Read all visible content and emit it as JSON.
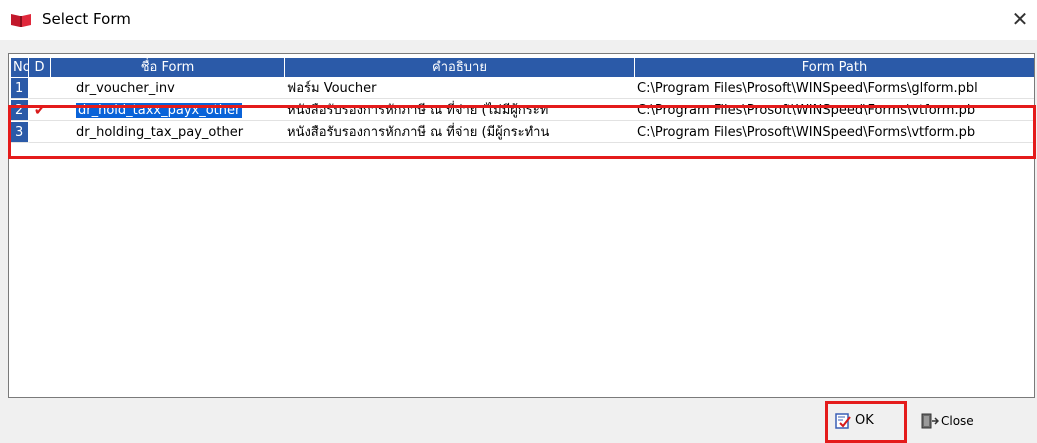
{
  "window": {
    "title": "Select Form",
    "close_glyph": "✕"
  },
  "grid": {
    "columns": [
      "No.",
      "D",
      "ชื่อ Form",
      "คำอธิบาย",
      "Form Path"
    ],
    "rows": [
      {
        "no": "1",
        "d": "",
        "form": "dr_voucher_inv",
        "desc": "ฟอร์ม Voucher",
        "path": "C:\\Program Files\\Prosoft\\WINSpeed\\Forms\\glform.pbl"
      },
      {
        "no": "2",
        "d": "✔",
        "form": "dr_hold_taxx_payx_other",
        "desc": "หนังสือรับรองการหักภาษี ณ ที่จ่าย (ไม่มีผู้กระท",
        "path": "C:\\Program Files\\Prosoft\\WINSpeed\\Forms\\vtform.pb"
      },
      {
        "no": "3",
        "d": "",
        "form": "dr_holding_tax_pay_other",
        "desc": "หนังสือรับรองการหักภาษี ณ ที่จ่าย (มีผู้กระทำน",
        "path": "C:\\Program Files\\Prosoft\\WINSpeed\\Forms\\vtform.pb"
      }
    ]
  },
  "buttons": {
    "ok_label": "OK",
    "close_label": "Close"
  },
  "colors": {
    "header_blue": "#2b5aa8",
    "selection_blue": "#0a63d8",
    "highlight_red": "#e41b1b",
    "check_red": "#d81b1b"
  }
}
